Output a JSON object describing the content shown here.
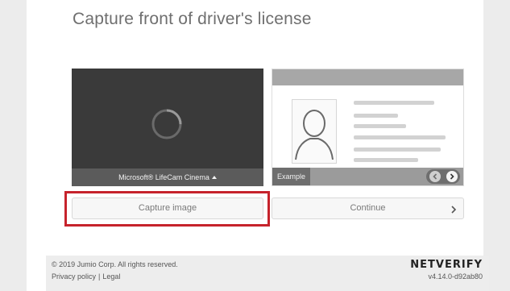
{
  "header": {
    "title": "Capture front of driver's license"
  },
  "camera": {
    "device_label": "Microsoft® LifeCam Cinema",
    "dropdown_icon": "caret-up-icon"
  },
  "example": {
    "label": "Example",
    "prev_icon": "chevron-left-icon",
    "next_icon": "chevron-right-icon"
  },
  "actions": {
    "capture_label": "Capture image",
    "continue_label": "Continue"
  },
  "footer": {
    "copyright": "© 2019 Jumio Corp. All rights reserved.",
    "privacy_label": "Privacy policy",
    "separator": "|",
    "legal_label": "Legal",
    "brand": "NETVERIFY",
    "version": "v4.14.0-d92ab80"
  },
  "colors": {
    "highlight": "#c6232c",
    "camera_bg": "#3a3a3a",
    "panel": "#ffffff"
  }
}
